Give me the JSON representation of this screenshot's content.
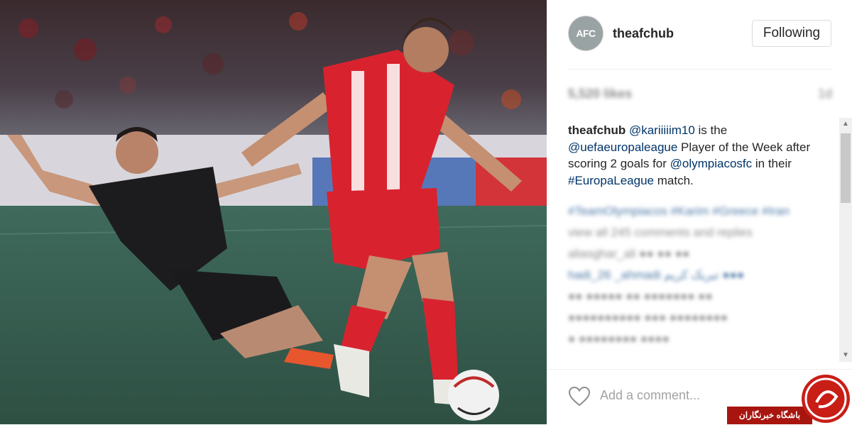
{
  "post": {
    "username": "theafchub",
    "avatar_text": "AFC",
    "follow_label": "Following",
    "likes_blurred": "5,520 likes",
    "time_blurred": "1d",
    "caption": {
      "user": "theafchub",
      "seg1": " ",
      "mention1": "@kariiiiim10",
      "seg2": " is the ",
      "mention2": "@uefaeuropaleague",
      "seg3": " Player of the Week after scoring 2 goals for ",
      "mention3": "@olympiacosfc",
      "seg4": " in their ",
      "hashtag": "#EuropaLeague",
      "seg5": " match."
    },
    "blurred_comments": [
      {
        "text": "#TeamOlympiacos #Karim #Greece #Iran",
        "blue": true
      },
      {
        "text": "view all 245 comments and replies",
        "blue": false
      },
      {
        "text": "aliasghar_ali ●● ●● ●●",
        "blue": false
      },
      {
        "text": "hadi_26 _ahmadi تبریک کریم ●●●",
        "blue": true
      },
      {
        "text": "●● ●●●●● ●● ●●●●●●● ●●",
        "blue": false
      },
      {
        "text": "●●●●●●●●●● ●●● ●●●●●●●●",
        "blue": false
      },
      {
        "text": "● ●●●●●●●● ●●●●",
        "blue": false
      }
    ],
    "comment_placeholder": "Add a comment..."
  },
  "watermark": {
    "text": "باشگاه خبرنگاران"
  },
  "colors": {
    "link": "#003569",
    "watermark": "#a8150f",
    "jersey_red": "#d8232f"
  }
}
